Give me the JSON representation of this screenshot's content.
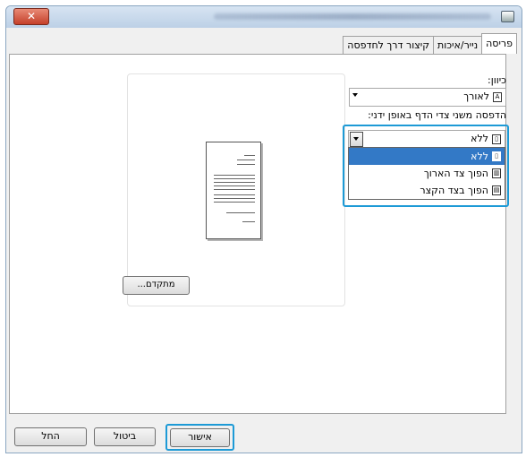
{
  "window": {
    "close_label": "✕"
  },
  "tabs": [
    {
      "label": "פריסה",
      "active": true
    },
    {
      "label": "נייר/איכות",
      "active": false
    },
    {
      "label": "קיצור דרך לחדפסה",
      "active": false
    }
  ],
  "orientation": {
    "label": "כיוון:",
    "value": "לאורך",
    "icon": "portrait-page-icon"
  },
  "duplex": {
    "label": "הדפסה משני צדי הדף באופן ידני:",
    "value": "ללא",
    "options": [
      {
        "label": "ללא",
        "icon": "single-page-icon",
        "selected": true
      },
      {
        "label": "הפוך צד הארוך",
        "icon": "flip-long-edge-icon",
        "selected": false
      },
      {
        "label": "הפוך בצד הקצר",
        "icon": "flip-short-edge-icon",
        "selected": false
      }
    ]
  },
  "advanced_button": "מתקדם...",
  "footer": {
    "ok": "אישור",
    "cancel": "ביטול",
    "apply": "החל"
  },
  "colors": {
    "accent": "#1d9ad6",
    "selection": "#3379c6"
  }
}
